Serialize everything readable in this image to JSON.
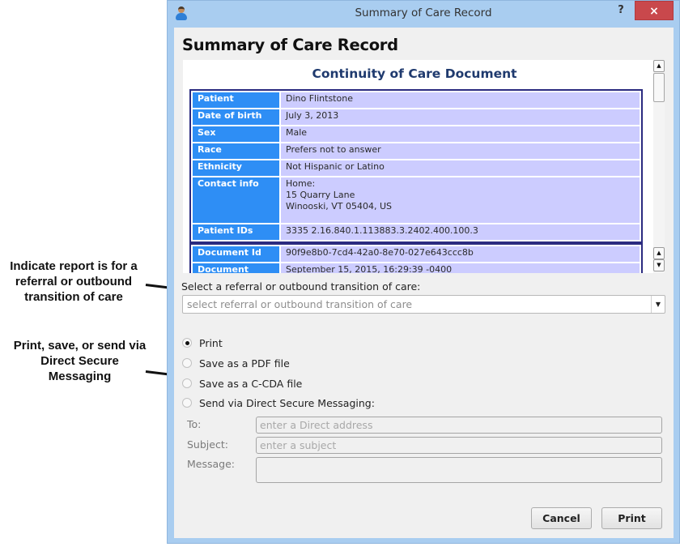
{
  "annotations": {
    "referral_note": "Indicate report is for a referral or outbound transition of care",
    "output_note": "Print, save, or send via Direct Secure Messaging"
  },
  "window": {
    "title": "Summary of Care Record",
    "help_label": "?",
    "close_label": "×"
  },
  "heading": "Summary of Care Record",
  "document": {
    "title": "Continuity of Care Document",
    "patient_rows": [
      {
        "key": "Patient",
        "value": "Dino Flintstone"
      },
      {
        "key": "Date of birth",
        "value": "July 3, 2013"
      },
      {
        "key": "Sex",
        "value": "Male"
      },
      {
        "key": "Race",
        "value": "Prefers not to answer"
      },
      {
        "key": "Ethnicity",
        "value": "Not Hispanic or Latino"
      },
      {
        "key": "Contact info",
        "value": "Home:\n15 Quarry Lane\nWinooski, VT 05404, US"
      },
      {
        "key": "Patient IDs",
        "value": "3335 2.16.840.1.113883.3.2402.400.100.3"
      }
    ],
    "document_rows": [
      {
        "key": "Document Id",
        "value": "90f9e8b0-7cd4-42a0-8e70-027e643ccc8b"
      },
      {
        "key": "Document",
        "value": "September 15, 2015, 16:29:39 -0400"
      }
    ]
  },
  "referral": {
    "label": "Select a referral or outbound transition of care:",
    "placeholder": "select referral or outbound transition of care"
  },
  "output_options": [
    {
      "label": "Print",
      "checked": true
    },
    {
      "label": "Save as a PDF file",
      "checked": false
    },
    {
      "label": "Save as a C-CDA file",
      "checked": false
    },
    {
      "label": "Send via Direct Secure Messaging:",
      "checked": false
    }
  ],
  "direct_message": {
    "to_label": "To:",
    "to_placeholder": "enter a Direct address",
    "subject_label": "Subject:",
    "subject_placeholder": "enter a subject",
    "message_label": "Message:",
    "message_value": ""
  },
  "buttons": {
    "cancel": "Cancel",
    "print": "Print"
  }
}
